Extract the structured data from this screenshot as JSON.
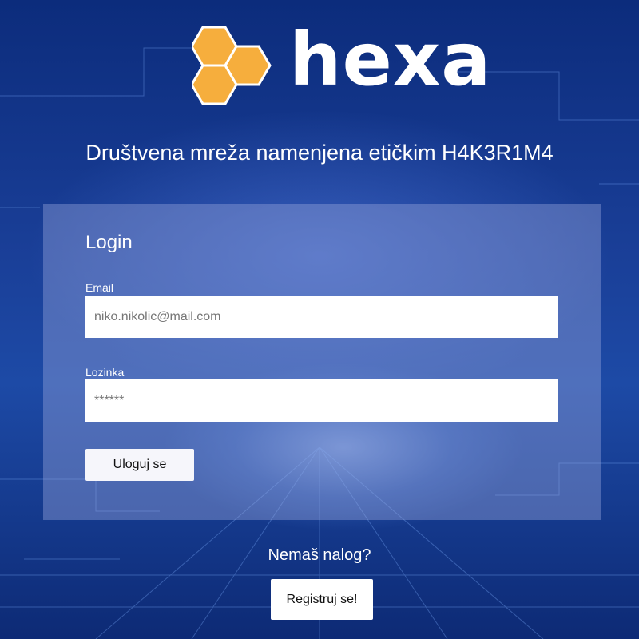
{
  "brand": {
    "name": "hexa",
    "logo_color": "#F6AE3D",
    "logo_icon": "honeycomb-icon"
  },
  "tagline": "Društvena mreža namenjena etičkim H4K3R1M4",
  "login": {
    "title": "Login",
    "email_label": "Email",
    "email_placeholder": "niko.nikolic@mail.com",
    "password_label": "Lozinka",
    "password_placeholder": "******",
    "submit_label": "Uloguj se"
  },
  "register": {
    "prompt": "Nemaš nalog?",
    "button_label": "Registruj se!"
  },
  "colors": {
    "background": "#0B2A78",
    "panel": "rgba(150,165,220,0.42)",
    "button": "#F6F6FB"
  }
}
